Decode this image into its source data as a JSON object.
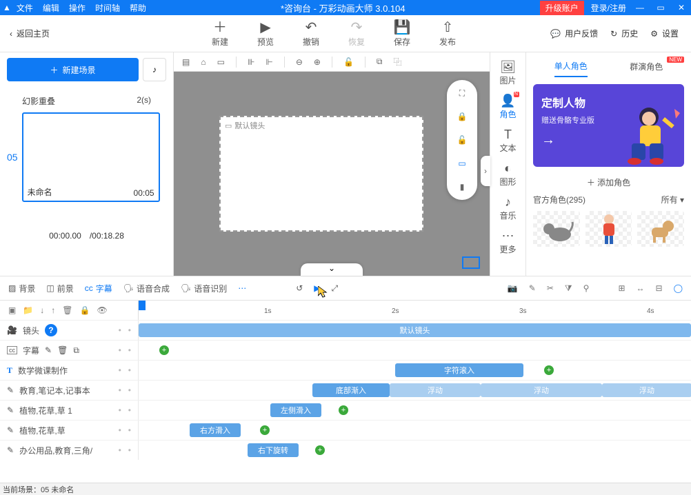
{
  "titlebar": {
    "menus": [
      "文件",
      "编辑",
      "操作",
      "时间轴",
      "帮助"
    ],
    "title": "*咨询台 - 万彩动画大师 3.0.104",
    "upgrade": "升级账户",
    "login": "登录/注册"
  },
  "toolbar": {
    "back": "返回主页",
    "buttons": [
      {
        "icon": "＋",
        "label": "新建"
      },
      {
        "icon": "▶",
        "label": "预览"
      },
      {
        "icon": "↶",
        "label": "撤销"
      },
      {
        "icon": "↷",
        "label": "恢复",
        "disabled": true
      },
      {
        "icon": "💾",
        "label": "保存"
      },
      {
        "icon": "⇧",
        "label": "发布"
      }
    ],
    "right": [
      {
        "icon": "💬",
        "label": "用户反馈"
      },
      {
        "icon": "↻",
        "label": "历史"
      },
      {
        "icon": "⚙",
        "label": "设置"
      }
    ]
  },
  "leftpanel": {
    "newscene": "新建场景",
    "overlap_label": "幻影重叠",
    "overlap_value": "2(s)",
    "scene_index": "05",
    "thumb_name": "未命名",
    "thumb_time": "00:05",
    "current_time": "00:00.00",
    "total_time": "/00:18.28"
  },
  "canvas": {
    "camera_label": "默认镜头"
  },
  "sidetabs": [
    {
      "icon": "🖼",
      "label": "图片"
    },
    {
      "icon": "👤",
      "label": "角色",
      "active": true,
      "badge": "N"
    },
    {
      "icon": "T",
      "label": "文本"
    },
    {
      "icon": "◐",
      "label": "图形"
    },
    {
      "icon": "♪",
      "label": "音乐"
    },
    {
      "icon": "⋯",
      "label": "更多"
    }
  ],
  "rightpanel": {
    "tabs": {
      "single": "单人角色",
      "group": "群演角色",
      "new": "NEW"
    },
    "promo": {
      "line1": "定制人物",
      "line2": "赠送骨骼专业版"
    },
    "add_char": "＋ 添加角色",
    "category": "官方角色(295)",
    "all_label": "所有 ▾"
  },
  "midbar": {
    "tabs": [
      "背景",
      "前景",
      "字幕",
      "语音合成",
      "语音识别"
    ],
    "active": 2
  },
  "timeline": {
    "ticks": [
      "1s",
      "2s",
      "3s",
      "4s"
    ],
    "tracks": [
      {
        "icon": "🎥",
        "label": "镜头",
        "help": true
      },
      {
        "icon": "cc",
        "label": "字幕",
        "extra": true
      },
      {
        "icon": "T",
        "label": "数学微课制作"
      },
      {
        "icon": "✎",
        "label": "教育,笔记本,记事本"
      },
      {
        "icon": "✎",
        "label": "植物,花草,草 1"
      },
      {
        "icon": "✎",
        "label": "植物,花草,草"
      },
      {
        "icon": "✎",
        "label": "办公用品,教育,三角/"
      }
    ],
    "clips": {
      "camera": "默认镜头",
      "scroll": "字符滚入",
      "bottom_in": "底部渐入",
      "float": "浮动",
      "left_in": "左侧滑入",
      "right_in": "右方滑入",
      "rb_rotate": "右下旋转"
    }
  },
  "statusbar": "当前场景：05   未命名"
}
